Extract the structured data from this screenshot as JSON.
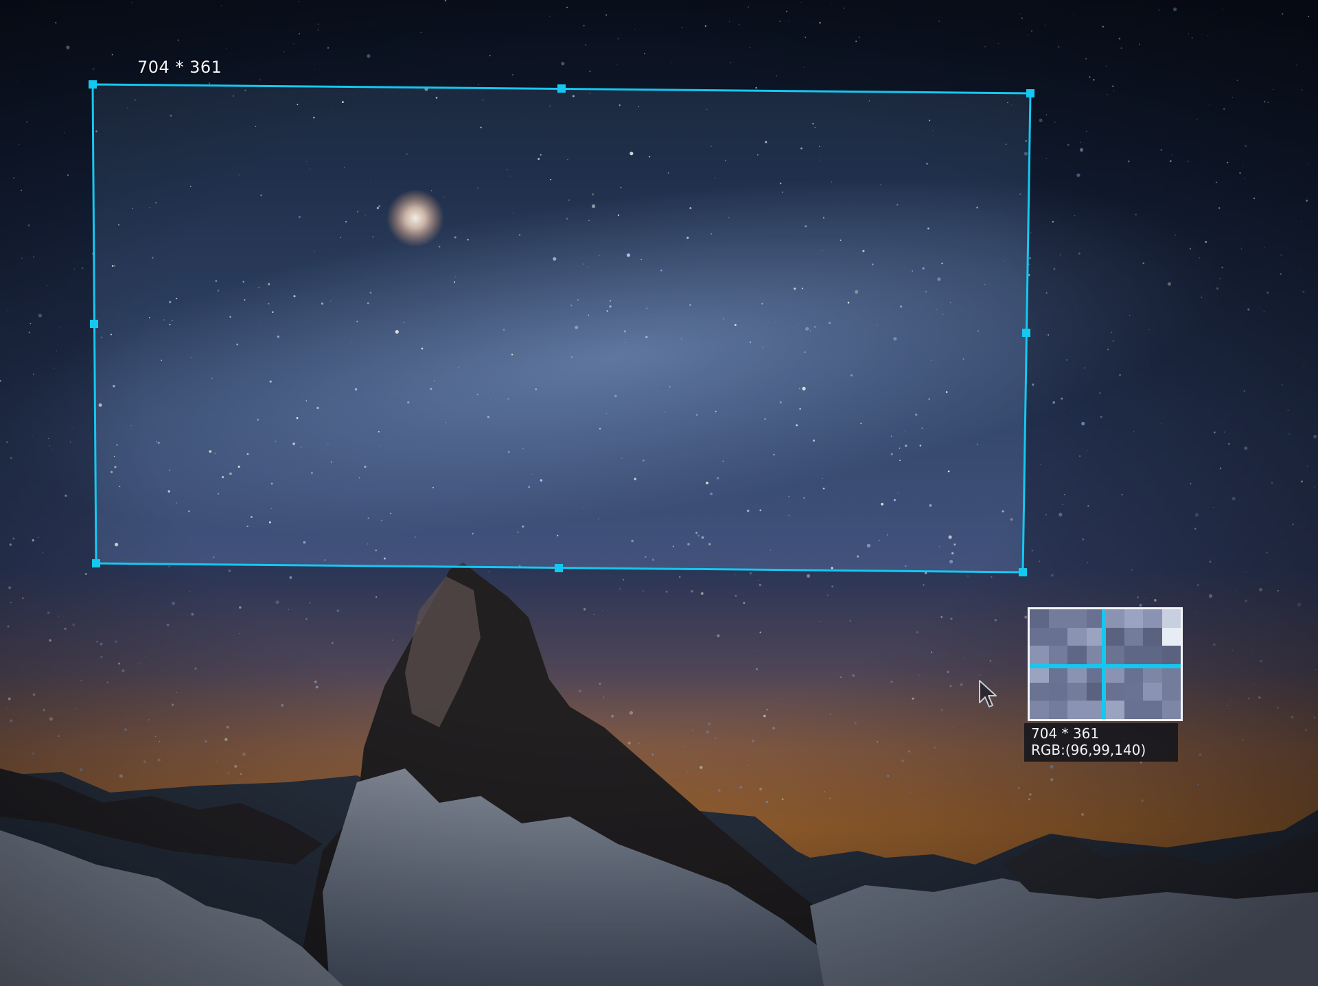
{
  "screenshot_tool": {
    "selection_size_label": "704 * 361",
    "info": {
      "size": "704 * 361",
      "rgb": "RGB:(96,99,140)"
    },
    "accent_color": "#14c8f0"
  },
  "wallpaper": {
    "subject": "starry night sky over a snowy mountain peak",
    "colors": {
      "sky_top": "#0d1524",
      "sky_mid": "#31456f",
      "horizon_glow": "#e08a3c",
      "snow": "#d5dde8",
      "rock": "#2a2624"
    }
  },
  "icons": {
    "cursor": "arrow-cursor-icon",
    "handle": "resize-handle-icon"
  }
}
